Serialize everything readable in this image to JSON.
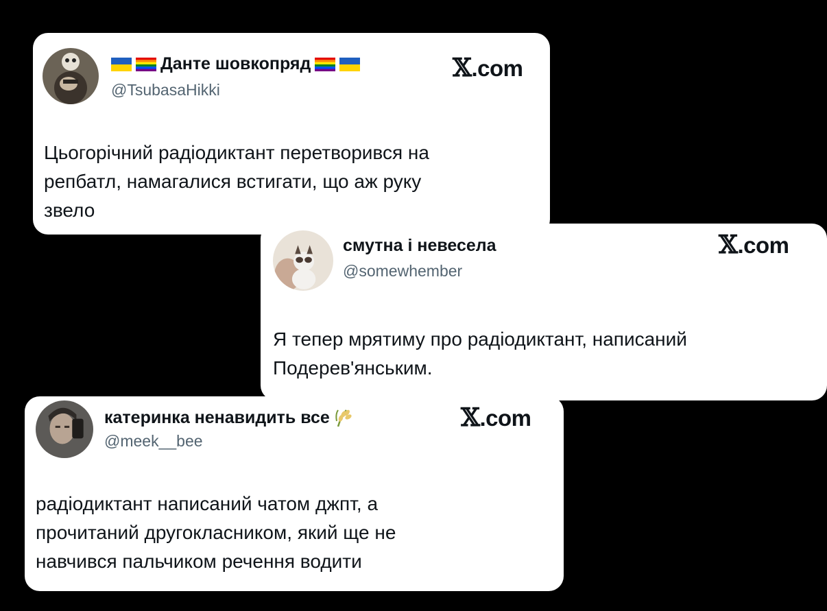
{
  "tweets": [
    {
      "name": "Данте шовкопряд",
      "handle": "@TsubasaHikki",
      "brand": ".com",
      "text_lines": [
        "Цьогорічний радіодиктант перетворився на",
        "репбатл, намагалися встигати, що аж руку",
        "звело"
      ]
    },
    {
      "name": "смутна і невесела",
      "handle": "@somewhember",
      "brand": ".com",
      "text_lines": [
        "Я тепер мрятиму про радіодиктант, написаний",
        "Подерев'янським."
      ]
    },
    {
      "name": "катеринка ненавидить все",
      "handle": "@meek__bee",
      "brand": ".com",
      "text_lines": [
        "радіодиктант написаний чатом джпт, а",
        "прочитаний другокласником, який ще не",
        "навчився пальчиком речення водити"
      ]
    }
  ],
  "colors": {
    "background": "#000000",
    "card": "#ffffff",
    "text": "#0f1419",
    "handle": "#536471",
    "flag_blue": "#1f5fbf",
    "flag_yellow": "#ffd300"
  }
}
